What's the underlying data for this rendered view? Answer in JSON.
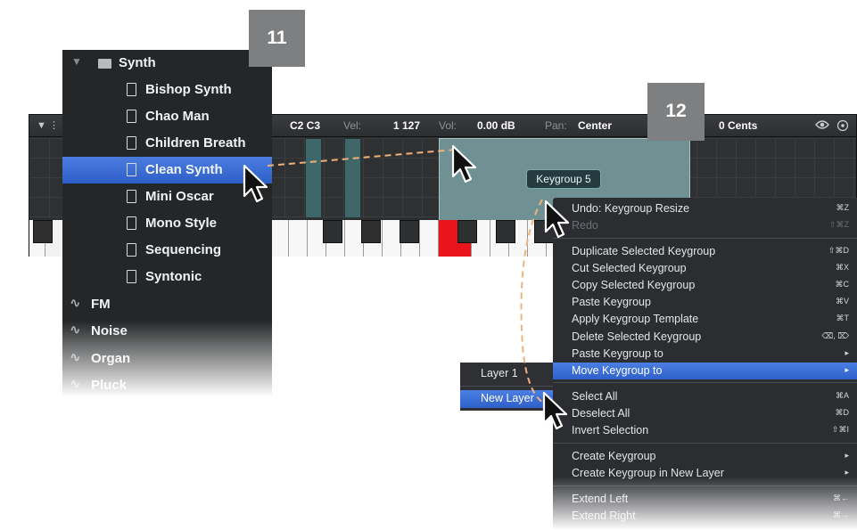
{
  "badges": {
    "step_a": "11",
    "step_b": "12"
  },
  "editor": {
    "header": {
      "range_value": "C2 C3",
      "vel_label": "Vel:",
      "vel_value": "1 127",
      "vol_label": "Vol:",
      "vol_value": "0.00 dB",
      "pan_label": "Pan:",
      "pan_value": "Center",
      "tune_value": "0 Cents"
    },
    "tooltip": "Keygroup 5"
  },
  "browser": {
    "folder": "Synth",
    "presets": [
      "Bishop Synth",
      "Chao Man",
      "Children Breath",
      "Clean Synth",
      "Mini Oscar",
      "Mono Style",
      "Sequencing",
      "Syntonic"
    ],
    "selected": "Clean Synth",
    "categories": [
      "FM",
      "Noise",
      "Organ",
      "Pluck"
    ]
  },
  "context_menu": {
    "items": [
      {
        "label": "Undo: Keygroup Resize",
        "shortcut": "⌘Z",
        "disabled": false
      },
      {
        "label": "Redo",
        "shortcut": "⇧⌘Z",
        "disabled": true
      },
      {
        "label": "Duplicate Selected Keygroup",
        "shortcut": "⇧⌘D",
        "disabled": false
      },
      {
        "label": "Cut Selected Keygroup",
        "shortcut": "⌘X",
        "disabled": false
      },
      {
        "label": "Copy Selected Keygroup",
        "shortcut": "⌘C",
        "disabled": false
      },
      {
        "label": "Paste Keygroup",
        "shortcut": "⌘V",
        "disabled": false
      },
      {
        "label": "Apply Keygroup Template",
        "shortcut": "⌘T",
        "disabled": false
      },
      {
        "label": "Delete Selected Keygroup",
        "shortcut": "⌫, ⌦",
        "disabled": false
      },
      {
        "label": "Paste Keygroup to",
        "shortcut": "▸",
        "disabled": false
      },
      {
        "label": "Move Keygroup to",
        "shortcut": "▸",
        "disabled": false,
        "highlighted": true
      },
      {
        "label": "Select All",
        "shortcut": "⌘A",
        "disabled": false
      },
      {
        "label": "Deselect All",
        "shortcut": "⌘D",
        "disabled": false
      },
      {
        "label": "Invert Selection",
        "shortcut": "⇧⌘I",
        "disabled": false
      },
      {
        "label": "Create Keygroup",
        "shortcut": "▸",
        "disabled": false
      },
      {
        "label": "Create Keygroup in New Layer",
        "shortcut": "▸",
        "disabled": false
      },
      {
        "label": "Extend Left",
        "shortcut": "⌘←",
        "disabled": false
      },
      {
        "label": "Extend Right",
        "shortcut": "⌘→",
        "disabled": false
      }
    ]
  },
  "layer_submenu": {
    "items": [
      "Layer 1",
      "New Layer"
    ],
    "highlighted": "New Layer"
  },
  "colors": {
    "accent": "#2e60ca",
    "keygroup": "#6f9194",
    "selected_key": "#e8161a",
    "connector": "#f0b27a"
  }
}
